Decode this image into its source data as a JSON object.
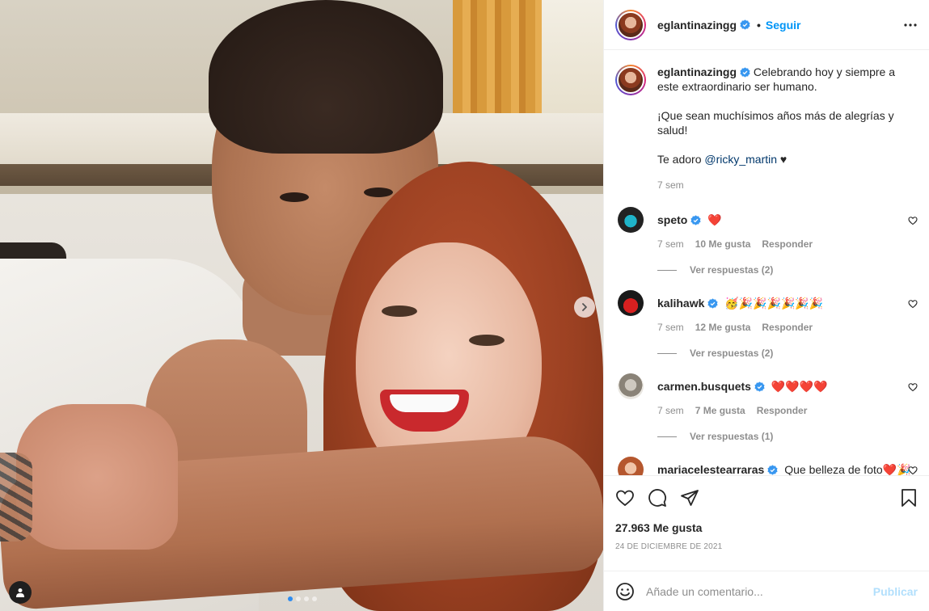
{
  "post": {
    "author": "eglantinazingg",
    "follow_label": "Seguir",
    "separator": "•",
    "caption": {
      "line1": "Celebrando hoy y siempre a este extraordinario ser humano.",
      "line2": "¡Que sean muchísimos años más de alegrías y salud!",
      "line3_prefix": "Te adoro ",
      "mention": "@ricky_martin",
      "line3_suffix": " ♥",
      "age": "7 sem"
    },
    "carousel": {
      "total": 4,
      "active": 1
    }
  },
  "comments": [
    {
      "user": "speto",
      "text": "❤️",
      "age": "7 sem",
      "likes": "10 Me gusta",
      "reply_label": "Responder",
      "replies": "Ver respuestas (2)"
    },
    {
      "user": "kalihawk",
      "text": "🥳🎉🎉🎉🎉🎉🎉",
      "age": "7 sem",
      "likes": "12 Me gusta",
      "reply_label": "Responder",
      "replies": "Ver respuestas (2)"
    },
    {
      "user": "carmen.busquets",
      "text": "❤️❤️❤️❤️",
      "age": "7 sem",
      "likes": "7 Me gusta",
      "reply_label": "Responder",
      "replies": "Ver respuestas (1)"
    },
    {
      "user": "mariacelestearraras",
      "text": "Que belleza de foto❤️🎉",
      "age": "",
      "likes": "",
      "reply_label": "",
      "replies": ""
    }
  ],
  "footer": {
    "likes_count": "27.963 Me gusta",
    "date": "24 DE DICIEMBRE DE 2021",
    "comment_placeholder": "Añade un comentario...",
    "publish_label": "Publicar"
  },
  "icons": {
    "verified": "verified-badge-icon",
    "more": "more-options-icon",
    "heart": "heart-icon",
    "comment": "comment-icon",
    "share": "share-icon",
    "save": "bookmark-icon",
    "emoji": "emoji-icon",
    "next": "chevron-right-icon",
    "tags": "user-tag-icon"
  },
  "colors": {
    "link": "#0095f6",
    "verified": "#3897f0",
    "publish_disabled": "#b2dffc",
    "mention": "#00376b",
    "muted": "#8e8e8e"
  }
}
